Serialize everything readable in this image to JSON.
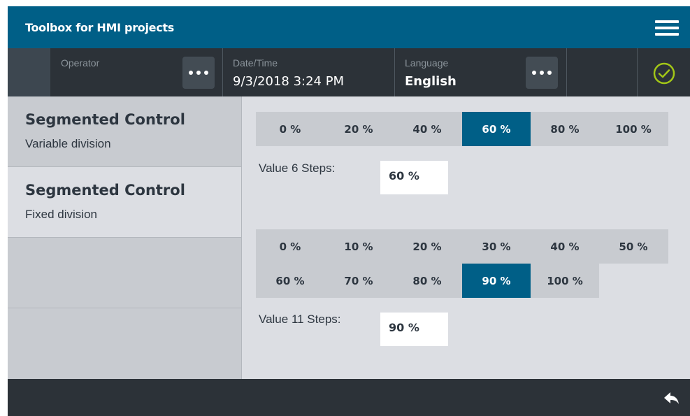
{
  "app": {
    "title": "Toolbox for HMI projects"
  },
  "statusbar": {
    "operator_label": "Operator",
    "datetime_label": "Date/Time",
    "datetime_value": "9/3/2018 3:24 PM",
    "language_label": "Language",
    "language_value": "English",
    "status_icon": "check-circle-icon"
  },
  "nav": {
    "items": [
      {
        "title": "Segmented Control",
        "subtitle": "Variable division",
        "active": false
      },
      {
        "title": "Segmented Control",
        "subtitle": "Fixed division",
        "active": true
      },
      {
        "title": "",
        "subtitle": ""
      },
      {
        "title": "",
        "subtitle": ""
      }
    ]
  },
  "control1": {
    "segments": [
      "0 %",
      "20 %",
      "40 %",
      "60 %",
      "80 %",
      "100 %"
    ],
    "selected": "60 %",
    "value_label": "Value 6 Steps:",
    "value": "60 %"
  },
  "control2": {
    "row1": [
      "0 %",
      "10 %",
      "20 %",
      "30 %",
      "40 %",
      "50 %"
    ],
    "row2": [
      "60 %",
      "70 %",
      "80 %",
      "90 %",
      "100 %"
    ],
    "selected": "90 %",
    "value_label": "Value 11 Steps:",
    "value": "90 %"
  },
  "colors": {
    "accent": "#005f87",
    "titlebar": "#005f87",
    "statusbar": "#2c3238",
    "ok_green": "#a2c617",
    "background": "#dcdee3",
    "segment_bg": "#c8cbd0"
  },
  "bottombar": {
    "back_icon": "back-arrow-icon"
  }
}
